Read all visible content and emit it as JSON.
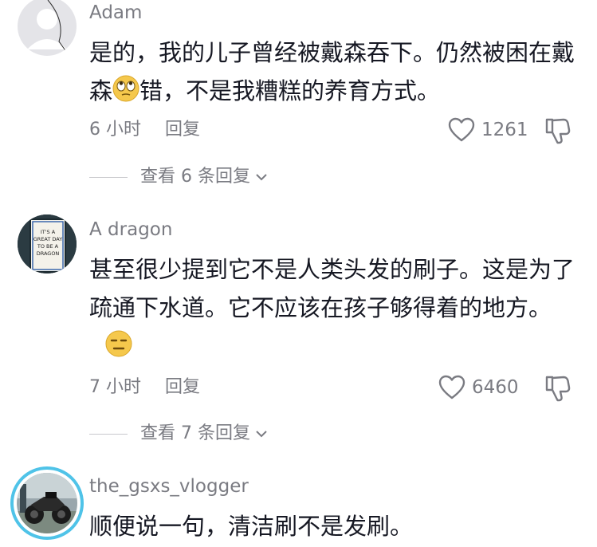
{
  "comments": [
    {
      "username": "Adam",
      "text_before_emoji": "是的，我的儿子曾经被戴森吞下。仍然被困在戴森",
      "text_after_emoji": "错，不是我糟糕的养育方式。",
      "time": "6 小时",
      "reply": "回复",
      "likes": "1261",
      "view_replies": "查看 6 条回复",
      "emoji": "rolling-eyes-emoji"
    },
    {
      "username": "A dragon",
      "avatar_sign": [
        "IT'S A",
        "GREAT DAY",
        "TO BE A",
        "DRAGON"
      ],
      "text": "甚至很少提到它不是人类头发的刷子。这是为了疏通下水道。它不应该在孩子够得着的地方。",
      "time": "7 小时",
      "reply": "回复",
      "likes": "6460",
      "view_replies": "查看 7 条回复",
      "emoji": "expressionless-emoji"
    },
    {
      "username": "the_gsxs_vlogger",
      "text": "顺便说一句，清洁刷不是发刷。",
      "avatar": "motorcycle-photo"
    }
  ],
  "icons": {
    "like": "heart-icon",
    "dislike": "thumbs-down-icon",
    "expand": "chevron-down-icon"
  },
  "colors": {
    "text": "#161823",
    "meta": "#7a7b82",
    "story_ring": "#4fc3e8"
  }
}
